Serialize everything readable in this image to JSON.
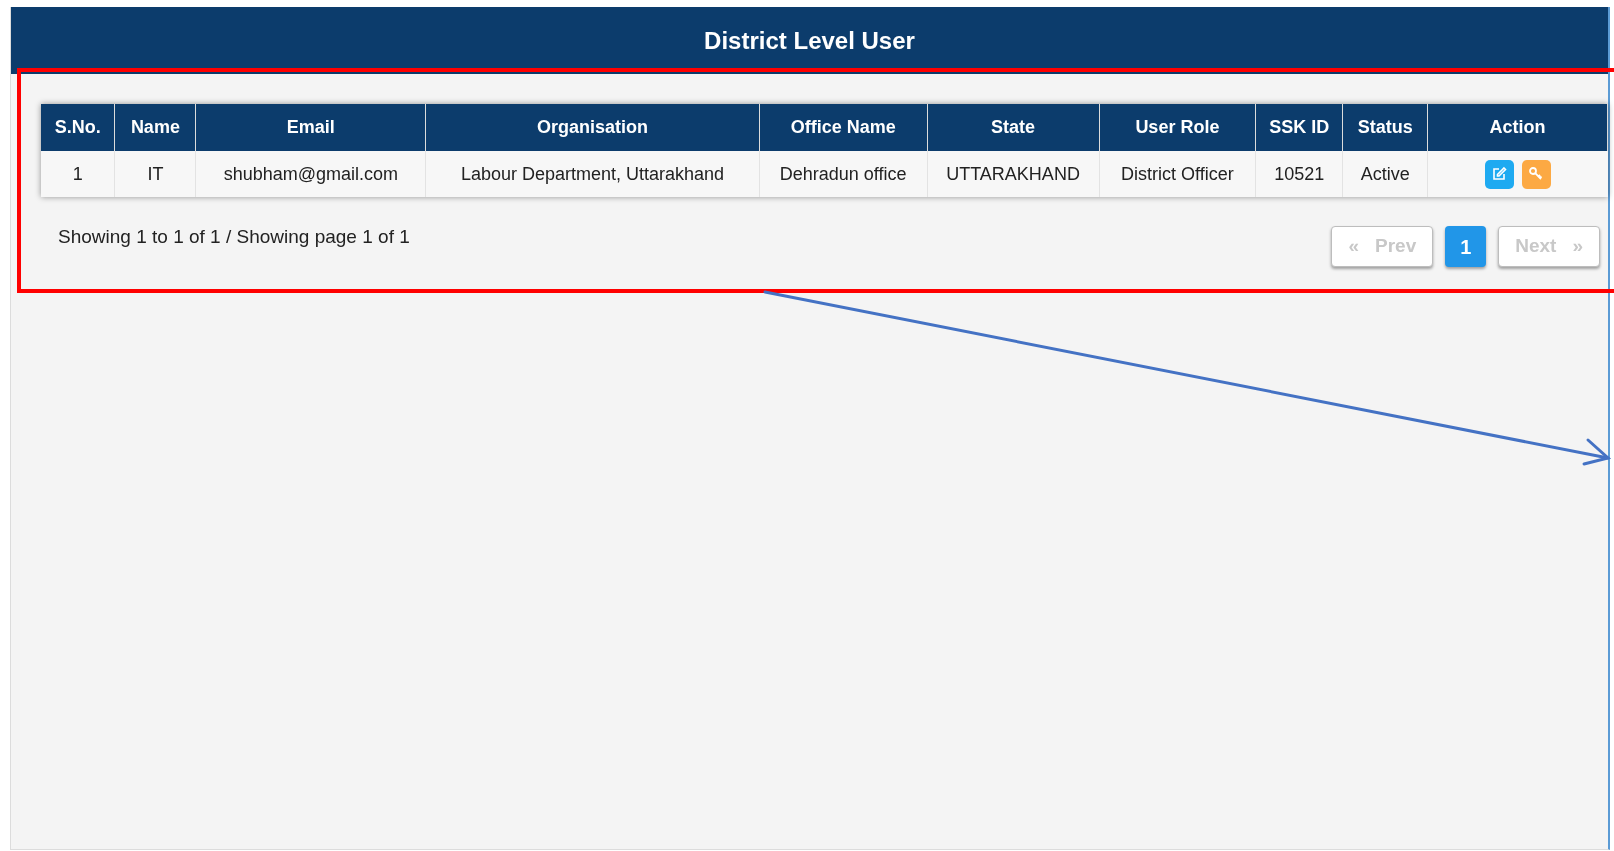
{
  "panel": {
    "title": "District Level User"
  },
  "table": {
    "columns": [
      "S.No.",
      "Name",
      "Email",
      "Organisation",
      "Office Name",
      "State",
      "User Role",
      "SSK ID",
      "Status",
      "Action"
    ],
    "rows": [
      {
        "cells": [
          "1",
          "IT",
          "shubham@gmail.com",
          "Labour Department, Uttarakhand",
          "Dehradun office",
          "UTTARAKHAND",
          "District Officer",
          "10521",
          "Active"
        ],
        "actions": [
          {
            "kind": "edit",
            "color": "#1eaaf1"
          },
          {
            "kind": "key",
            "color": "#fca943"
          }
        ]
      }
    ]
  },
  "summary": "Showing 1 to 1 of 1 / Showing page 1 of 1",
  "pagination": {
    "prev": {
      "arrow": "«",
      "label": "Prev",
      "disabled": true
    },
    "pages": [
      {
        "label": "1",
        "selected": true
      }
    ],
    "next": {
      "label": "Next",
      "arrow": "»",
      "disabled": true
    }
  }
}
